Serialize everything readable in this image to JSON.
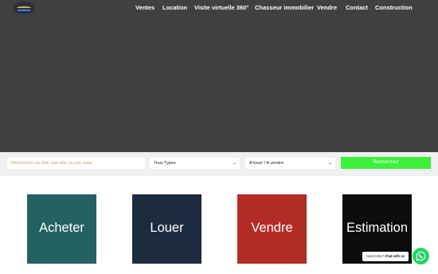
{
  "nav": {
    "items": [
      "Ventes",
      "Location",
      "Visite virtuelle 360°",
      "Chasseur immobilier",
      "Vendre",
      "Contact",
      "Construction"
    ]
  },
  "search": {
    "placeholder": "Rechercher un état, une ville ou une zone",
    "type_select": "Tous Types",
    "mode_select": "A louer / A vendre",
    "button_label": "Recherchez"
  },
  "tiles": [
    {
      "label": "Acheter",
      "color": "#246162"
    },
    {
      "label": "Louer",
      "color": "#1d2b3e"
    },
    {
      "label": "Vendre",
      "color": "#b22b27"
    },
    {
      "label": "Estimation",
      "color": "#0d0d0d"
    }
  ],
  "chat": {
    "prefix": "Need Help? ",
    "label": "Chat with us"
  },
  "colors": {
    "hero": "#404040",
    "search_button": "#3ef03a",
    "whatsapp": "#25d366"
  },
  "icons": [
    "logo-icon",
    "chevron-down-icon",
    "whatsapp-icon"
  ]
}
